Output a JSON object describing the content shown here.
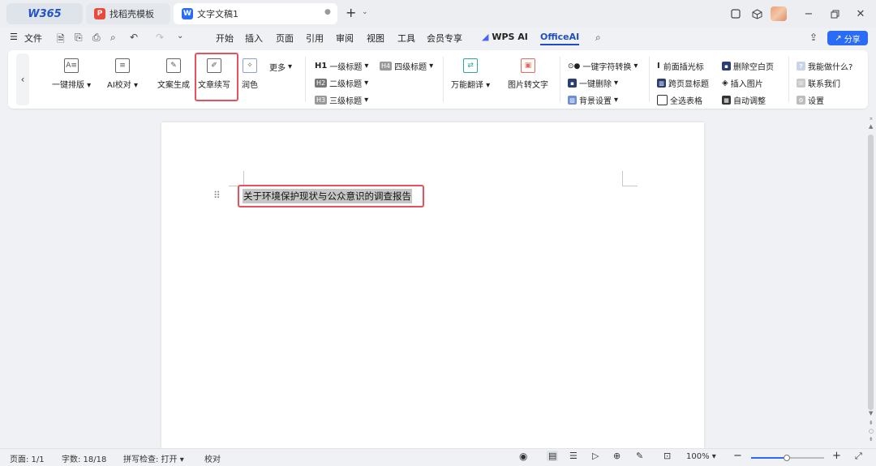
{
  "tabs": {
    "home_label": "W365",
    "template_label": "找稻壳模板",
    "doc_label": "文字文稿1",
    "template_icon": "P",
    "doc_icon": "W"
  },
  "menu": {
    "file": "文件",
    "items": [
      "开始",
      "插入",
      "页面",
      "引用",
      "审阅",
      "视图",
      "工具",
      "会员专享"
    ],
    "wps_ai": "WPS AI",
    "office_ai": "OfficeAI",
    "share": "分享"
  },
  "ribbon": {
    "one_click_layout": "一键排版",
    "ai_proofread": "AI校对",
    "copy_gen": "文案生成",
    "article_continue": "文章续写",
    "polish": "润色",
    "more": "更多",
    "h1": "一级标题",
    "h2": "二级标题",
    "h3": "三级标题",
    "h4": "四级标题",
    "translate": "万能翻译",
    "img_to_text": "图片转文字",
    "char_convert": "一键字符转换",
    "one_click_delete": "一键删除",
    "bg_settings": "背景设置",
    "cursor_mark": "前面插光标",
    "cross_page_title": "跨页显标题",
    "select_all_tables": "全选表格",
    "delete_blank_page": "删除空白页",
    "insert_image": "插入图片",
    "auto_adjust": "自动调整",
    "what_can_i_do": "我能做什么?",
    "contact_us": "联系我们",
    "settings": "设置"
  },
  "document": {
    "title_text": "关于环境保护现状与公众意识的调查报告"
  },
  "status": {
    "page": "页面: 1/1",
    "word_count": "字数: 18/18",
    "spell_check": "拼写检查: 打开",
    "proofread": "校对",
    "zoom": "100%"
  },
  "colors": {
    "accent": "#2a6cf6",
    "highlight_border": "#e8505b"
  }
}
